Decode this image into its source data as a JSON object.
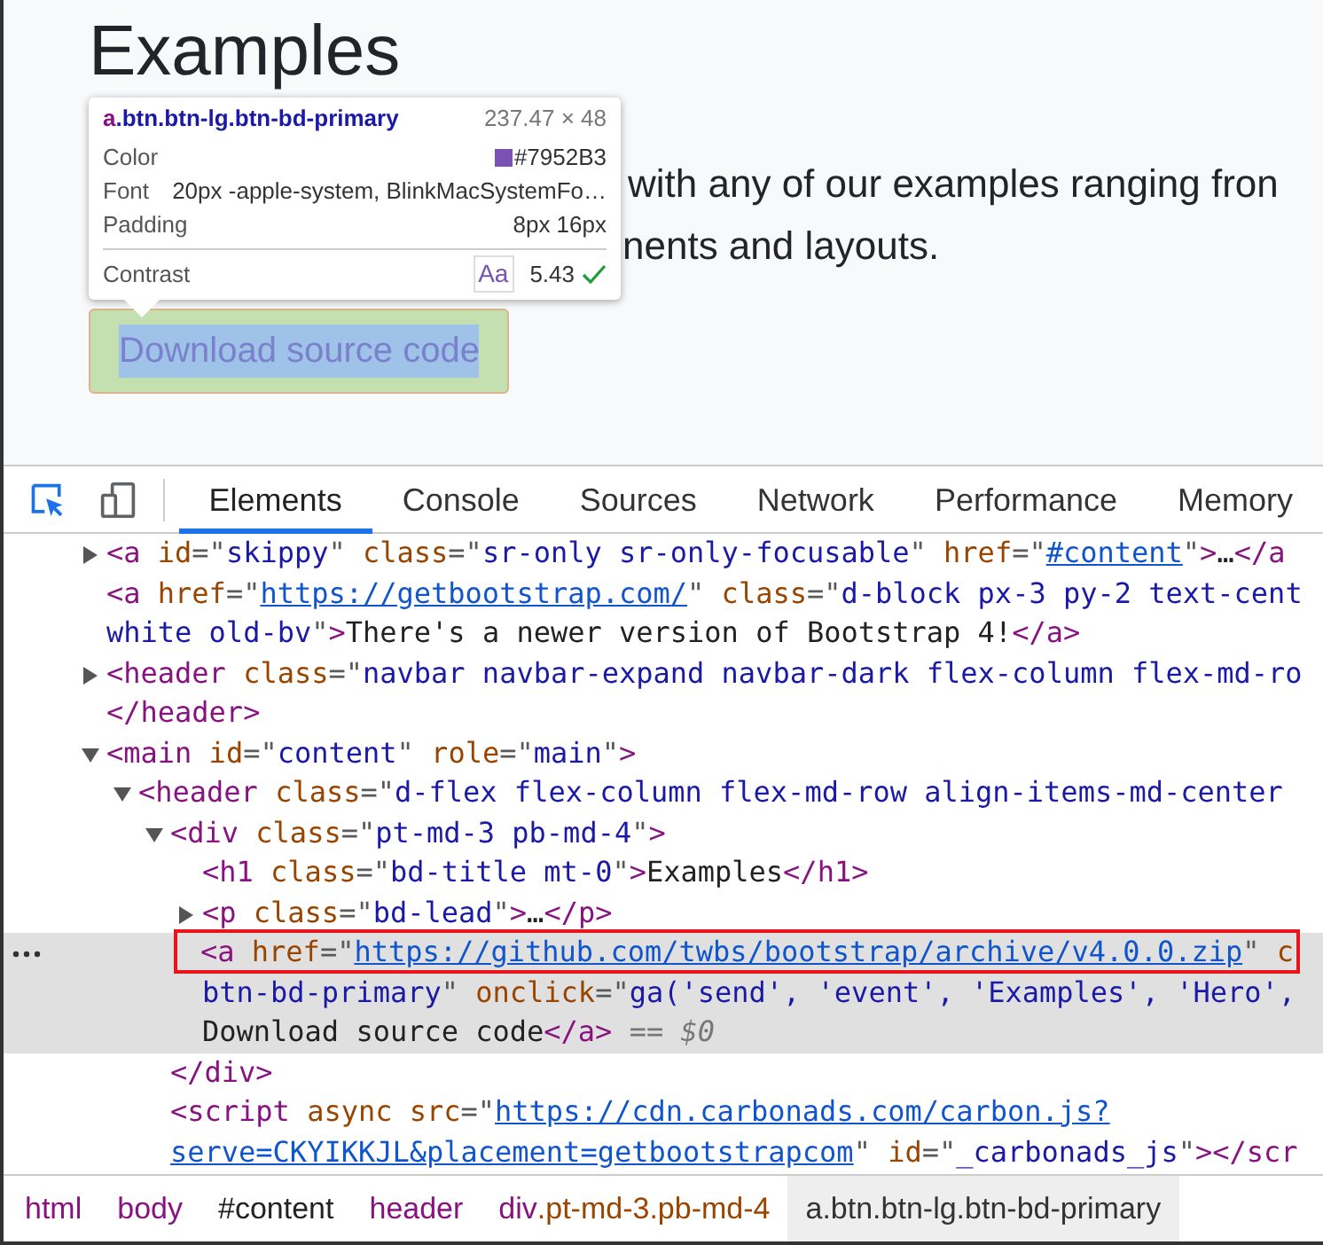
{
  "preview": {
    "heading": "Examples",
    "lead_lines": [
      "with any of our examples ranging fron",
      "nents and layouts."
    ],
    "button": "Download source code",
    "tooltip": {
      "tag": "a",
      "classes": ".btn.btn-lg.btn-bd-primary",
      "size": "237.47 × 48",
      "rows": [
        {
          "kind": "color",
          "label": "Color",
          "value": "#7952B3"
        },
        {
          "kind": "text",
          "label": "Font",
          "value": "20px -apple-system, BlinkMacSystemFo…"
        },
        {
          "kind": "text",
          "label": "Padding",
          "value": "8px 16px"
        }
      ],
      "contrast": {
        "label": "Contrast",
        "sample": "Aa",
        "ratio": "5.43",
        "passes": true
      }
    }
  },
  "toolbar": {
    "tabs": [
      {
        "label": "Elements",
        "selected": true
      },
      {
        "label": "Console",
        "selected": false
      },
      {
        "label": "Sources",
        "selected": false
      },
      {
        "label": "Network",
        "selected": false
      },
      {
        "label": "Performance",
        "selected": false
      },
      {
        "label": "Memory",
        "selected": false
      }
    ]
  },
  "dom_tree": [
    {
      "expanded": false,
      "selected": false,
      "outlined": false,
      "lines": [
        [
          {
            "kind": "tag",
            "text": "<a"
          },
          {
            "kind": "attr",
            "text": " id"
          },
          {
            "kind": "punct",
            "text": "=\""
          },
          {
            "kind": "value",
            "text": "skippy"
          },
          {
            "kind": "punct",
            "text": "\""
          },
          {
            "kind": "attr",
            "text": " class"
          },
          {
            "kind": "punct",
            "text": "=\""
          },
          {
            "kind": "value",
            "text": "sr-only sr-only-focusable"
          },
          {
            "kind": "punct",
            "text": "\""
          },
          {
            "kind": "attr",
            "text": " href"
          },
          {
            "kind": "punct",
            "text": "=\""
          },
          {
            "kind": "link",
            "text": "#content"
          },
          {
            "kind": "punct",
            "text": "\""
          },
          {
            "kind": "tag",
            "text": ">"
          },
          {
            "kind": "text",
            "text": "…"
          },
          {
            "kind": "tag",
            "text": "</a"
          }
        ]
      ]
    },
    {
      "selected": false,
      "outlined": false,
      "lines": [
        [
          {
            "kind": "tag",
            "text": "<a"
          },
          {
            "kind": "attr",
            "text": " href"
          },
          {
            "kind": "punct",
            "text": "=\""
          },
          {
            "kind": "link",
            "text": "https://getbootstrap.com/"
          },
          {
            "kind": "punct",
            "text": "\""
          },
          {
            "kind": "attr",
            "text": " class"
          },
          {
            "kind": "punct",
            "text": "=\""
          },
          {
            "kind": "value",
            "text": "d-block px-3 py-2 text-cent"
          }
        ],
        [
          {
            "kind": "value",
            "text": "white old-bv"
          },
          {
            "kind": "punct",
            "text": "\""
          },
          {
            "kind": "tag",
            "text": ">"
          },
          {
            "kind": "text",
            "text": "There's a newer version of Bootstrap 4!"
          },
          {
            "kind": "tag",
            "text": "</a>"
          }
        ]
      ]
    },
    {
      "expanded": false,
      "selected": false,
      "outlined": false,
      "lines": [
        [
          {
            "kind": "tag",
            "text": "<header"
          },
          {
            "kind": "attr",
            "text": " class"
          },
          {
            "kind": "punct",
            "text": "=\""
          },
          {
            "kind": "value",
            "text": "navbar navbar-expand navbar-dark flex-column flex-md-ro"
          }
        ]
      ],
      "closing": [
        [
          {
            "kind": "tag",
            "text": "</header>"
          }
        ]
      ]
    },
    {
      "expanded": true,
      "selected": false,
      "outlined": false,
      "lines": [
        [
          {
            "kind": "tag",
            "text": "<main"
          },
          {
            "kind": "attr",
            "text": " id"
          },
          {
            "kind": "punct",
            "text": "=\""
          },
          {
            "kind": "value",
            "text": "content"
          },
          {
            "kind": "punct",
            "text": "\""
          },
          {
            "kind": "attr",
            "text": " role"
          },
          {
            "kind": "punct",
            "text": "=\""
          },
          {
            "kind": "value",
            "text": "main"
          },
          {
            "kind": "punct",
            "text": "\""
          },
          {
            "kind": "tag",
            "text": ">"
          }
        ]
      ],
      "children": [
        {
          "expanded": true,
          "selected": false,
          "outlined": false,
          "lines": [
            [
              {
                "kind": "tag",
                "text": "<header"
              },
              {
                "kind": "attr",
                "text": " class"
              },
              {
                "kind": "punct",
                "text": "=\""
              },
              {
                "kind": "value",
                "text": "d-flex flex-column flex-md-row align-items-md-center"
              }
            ]
          ],
          "children": [
            {
              "expanded": true,
              "selected": false,
              "outlined": false,
              "lines": [
                [
                  {
                    "kind": "tag",
                    "text": "<div"
                  },
                  {
                    "kind": "attr",
                    "text": " class"
                  },
                  {
                    "kind": "punct",
                    "text": "=\""
                  },
                  {
                    "kind": "value",
                    "text": "pt-md-3 pb-md-4"
                  },
                  {
                    "kind": "punct",
                    "text": "\""
                  },
                  {
                    "kind": "tag",
                    "text": ">"
                  }
                ]
              ],
              "children": [
                {
                  "selected": false,
                  "outlined": false,
                  "lines": [
                    [
                      {
                        "kind": "tag",
                        "text": "<h1"
                      },
                      {
                        "kind": "attr",
                        "text": " class"
                      },
                      {
                        "kind": "punct",
                        "text": "=\""
                      },
                      {
                        "kind": "value",
                        "text": "bd-title mt-0"
                      },
                      {
                        "kind": "punct",
                        "text": "\""
                      },
                      {
                        "kind": "tag",
                        "text": ">"
                      },
                      {
                        "kind": "text",
                        "text": "Examples"
                      },
                      {
                        "kind": "tag",
                        "text": "</h1>"
                      }
                    ]
                  ]
                },
                {
                  "expanded": false,
                  "selected": false,
                  "outlined": false,
                  "lines": [
                    [
                      {
                        "kind": "tag",
                        "text": "<p"
                      },
                      {
                        "kind": "attr",
                        "text": " class"
                      },
                      {
                        "kind": "punct",
                        "text": "=\""
                      },
                      {
                        "kind": "value",
                        "text": "bd-lead"
                      },
                      {
                        "kind": "punct",
                        "text": "\""
                      },
                      {
                        "kind": "tag",
                        "text": ">"
                      },
                      {
                        "kind": "text",
                        "text": "…"
                      },
                      {
                        "kind": "tag",
                        "text": "</p>"
                      }
                    ]
                  ]
                },
                {
                  "selected": true,
                  "outlined": true,
                  "lines": [
                    [
                      {
                        "kind": "tag",
                        "text": "<a"
                      },
                      {
                        "kind": "attr",
                        "text": " href"
                      },
                      {
                        "kind": "punct",
                        "text": "=\""
                      },
                      {
                        "kind": "link",
                        "text": "https://github.com/twbs/bootstrap/archive/v4.0.0.zip"
                      },
                      {
                        "kind": "punct",
                        "text": "\""
                      },
                      {
                        "kind": "attr",
                        "text": " c"
                      }
                    ],
                    [
                      {
                        "kind": "value",
                        "text": "btn-bd-primary"
                      },
                      {
                        "kind": "punct",
                        "text": "\""
                      },
                      {
                        "kind": "attr",
                        "text": " onclick"
                      },
                      {
                        "kind": "punct",
                        "text": "=\""
                      },
                      {
                        "kind": "value",
                        "text": "ga('send', 'event', 'Examples', 'Hero',"
                      }
                    ],
                    [
                      {
                        "kind": "text",
                        "text": "Download source code"
                      },
                      {
                        "kind": "tag",
                        "text": "</a>"
                      },
                      {
                        "kind": "hint",
                        "text": " == "
                      },
                      {
                        "kind": "var",
                        "text": "$0"
                      }
                    ]
                  ]
                }
              ],
              "closing": [
                [
                  {
                    "kind": "tag",
                    "text": "</div>"
                  }
                ]
              ]
            },
            {
              "selected": false,
              "outlined": false,
              "lines": [
                [
                  {
                    "kind": "tag",
                    "text": "<script"
                  },
                  {
                    "kind": "attr",
                    "text": " async src"
                  },
                  {
                    "kind": "punct",
                    "text": "=\""
                  },
                  {
                    "kind": "link",
                    "text": "https://cdn.carbonads.com/carbon.js?"
                  }
                ],
                [
                  {
                    "kind": "link",
                    "text": "serve=CKYIKKJL&placement=getbootstrapcom"
                  },
                  {
                    "kind": "punct",
                    "text": "\""
                  },
                  {
                    "kind": "attr",
                    "text": " id"
                  },
                  {
                    "kind": "punct",
                    "text": "=\""
                  },
                  {
                    "kind": "value",
                    "text": "_carbonads_js"
                  },
                  {
                    "kind": "punct",
                    "text": "\""
                  },
                  {
                    "kind": "tag",
                    "text": "></scr"
                  }
                ]
              ]
            }
          ]
        }
      ]
    }
  ],
  "breadcrumbs": [
    {
      "selected": false,
      "parts": [
        {
          "kind": "tag",
          "text": "html"
        }
      ]
    },
    {
      "selected": false,
      "parts": [
        {
          "kind": "tag",
          "text": "body"
        }
      ]
    },
    {
      "selected": false,
      "parts": [
        {
          "kind": "id",
          "text": "#content"
        }
      ]
    },
    {
      "selected": false,
      "parts": [
        {
          "kind": "tag",
          "text": "header"
        }
      ]
    },
    {
      "selected": false,
      "parts": [
        {
          "kind": "tag",
          "text": "div"
        },
        {
          "kind": "class",
          "text": ".pt-md-3.pb-md-4"
        }
      ]
    },
    {
      "selected": true,
      "parts": [
        {
          "kind": "tag",
          "text": "a"
        },
        {
          "kind": "class",
          "text": ".btn.btn-lg.btn-bd-primary"
        }
      ]
    }
  ]
}
